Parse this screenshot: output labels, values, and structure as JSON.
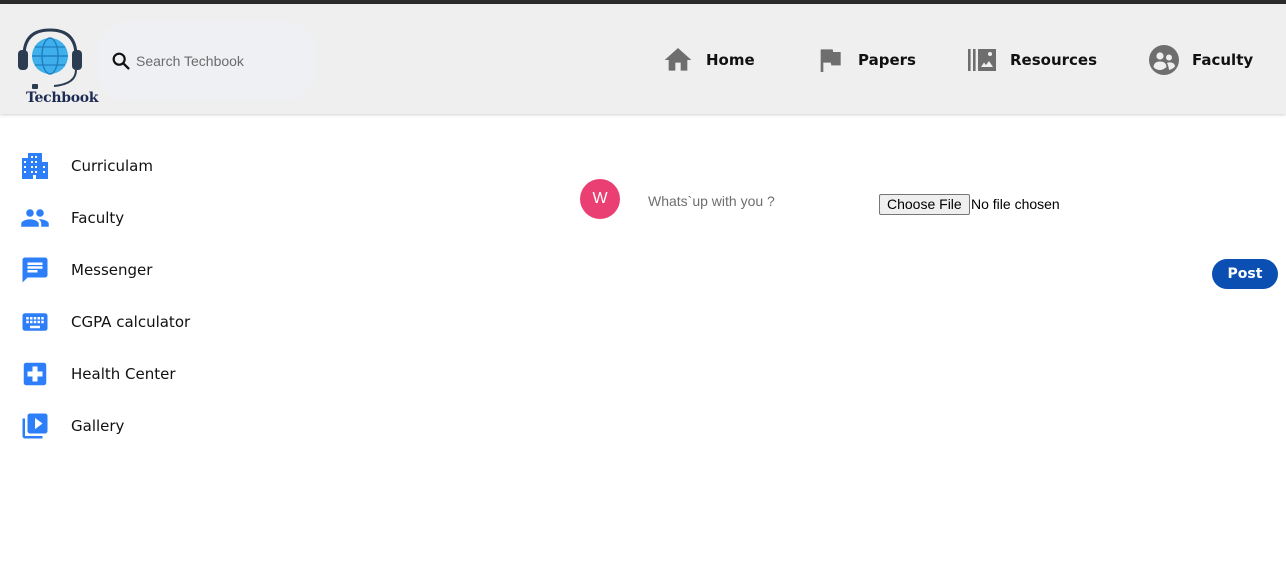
{
  "header": {
    "logo_text": "Techbook",
    "search": {
      "placeholder": "Search Techbook",
      "icon": "search-icon"
    },
    "nav": [
      {
        "label": "Home",
        "icon": "home-icon"
      },
      {
        "label": "Papers",
        "icon": "flag-icon"
      },
      {
        "label": "Resources",
        "icon": "photo-library-icon"
      },
      {
        "label": "Faculty",
        "icon": "supervised-user-icon"
      }
    ]
  },
  "sidebar": {
    "items": [
      {
        "label": "Curriculam",
        "icon": "building-icon"
      },
      {
        "label": "Faculty",
        "icon": "people-icon"
      },
      {
        "label": "Messenger",
        "icon": "chat-icon"
      },
      {
        "label": "CGPA calculator",
        "icon": "keyboard-icon"
      },
      {
        "label": "Health Center",
        "icon": "medical-cross-icon"
      },
      {
        "label": "Gallery",
        "icon": "video-library-icon"
      }
    ]
  },
  "composer": {
    "avatar_initial": "W",
    "placeholder": "Whats`up with you ?",
    "choose_file_label": "Choose File",
    "no_file_text": "No file chosen",
    "post_label": "Post"
  },
  "colors": {
    "header_bg": "#efefef",
    "accent_blue": "#2d7ff9",
    "post_button": "#0b4fb3",
    "avatar": "#ea3f73",
    "nav_icon": "#6e6e6e"
  }
}
